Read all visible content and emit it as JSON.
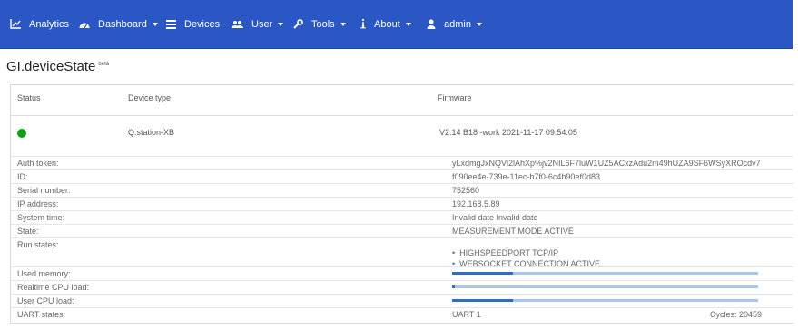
{
  "nav": {
    "items": [
      {
        "label": "Analytics",
        "icon": "chart-icon",
        "caret": false
      },
      {
        "label": "Dashboard",
        "icon": "dashboard-icon",
        "caret": true
      },
      {
        "label": "Devices",
        "icon": "list-icon",
        "caret": false
      },
      {
        "label": "User",
        "icon": "users-icon",
        "caret": true
      },
      {
        "label": "Tools",
        "icon": "wrench-icon",
        "caret": true
      },
      {
        "label": "About",
        "icon": "info-icon",
        "caret": true
      },
      {
        "label": "admin",
        "icon": "person-icon",
        "caret": true
      }
    ]
  },
  "page": {
    "title": "GI.deviceState",
    "badge": "beta"
  },
  "table": {
    "headers": {
      "status": "Status",
      "device_type": "Device type",
      "firmware": "Firmware"
    },
    "device": {
      "status": "online",
      "type": "Q.station-XB",
      "firmware": "V2.14 B18 -work 2021-11-17 09:54:05"
    }
  },
  "details": {
    "auth_token": {
      "label": "Auth token:",
      "value": "yLxdmgJxNQVl2lAhXp%jv2NIL6F7luW1UZ5ACxzAdu2m49hUZA9SF6WSyXROcdv7"
    },
    "id": {
      "label": "ID:",
      "value": "f090ee4e-739e-11ec-b7f0-6c4b90ef0d83"
    },
    "serial": {
      "label": "Serial number:",
      "value": "752560"
    },
    "ip": {
      "label": "IP address:",
      "value": "192.168.5.89"
    },
    "system_time": {
      "label": "System time:",
      "value": "Invalid date Invalid date"
    },
    "state": {
      "label": "State:",
      "value": "MEASUREMENT MODE ACTIVE"
    },
    "run_states": {
      "label": "Run states:",
      "items": [
        "HIGHSPEEDPORT TCP/IP",
        "WEBSOCKET CONNECTION ACTIVE"
      ]
    },
    "used_memory": {
      "label": "Used memory:",
      "value_fraction": 0.2
    },
    "realtime_cpu": {
      "label": "Realtime CPU load:",
      "value_fraction": 0.01
    },
    "user_cpu": {
      "label": "User CPU load:",
      "value_fraction": 0.2
    },
    "uart": {
      "label": "UART states:",
      "value": "UART 1",
      "cycles": "Cycles: 20459"
    }
  },
  "colors": {
    "navbar": "#2b57c4",
    "status_online": "#0ea01a",
    "bar_bg": "#a9c6e8",
    "bar_fill": "#2f6cc2"
  }
}
